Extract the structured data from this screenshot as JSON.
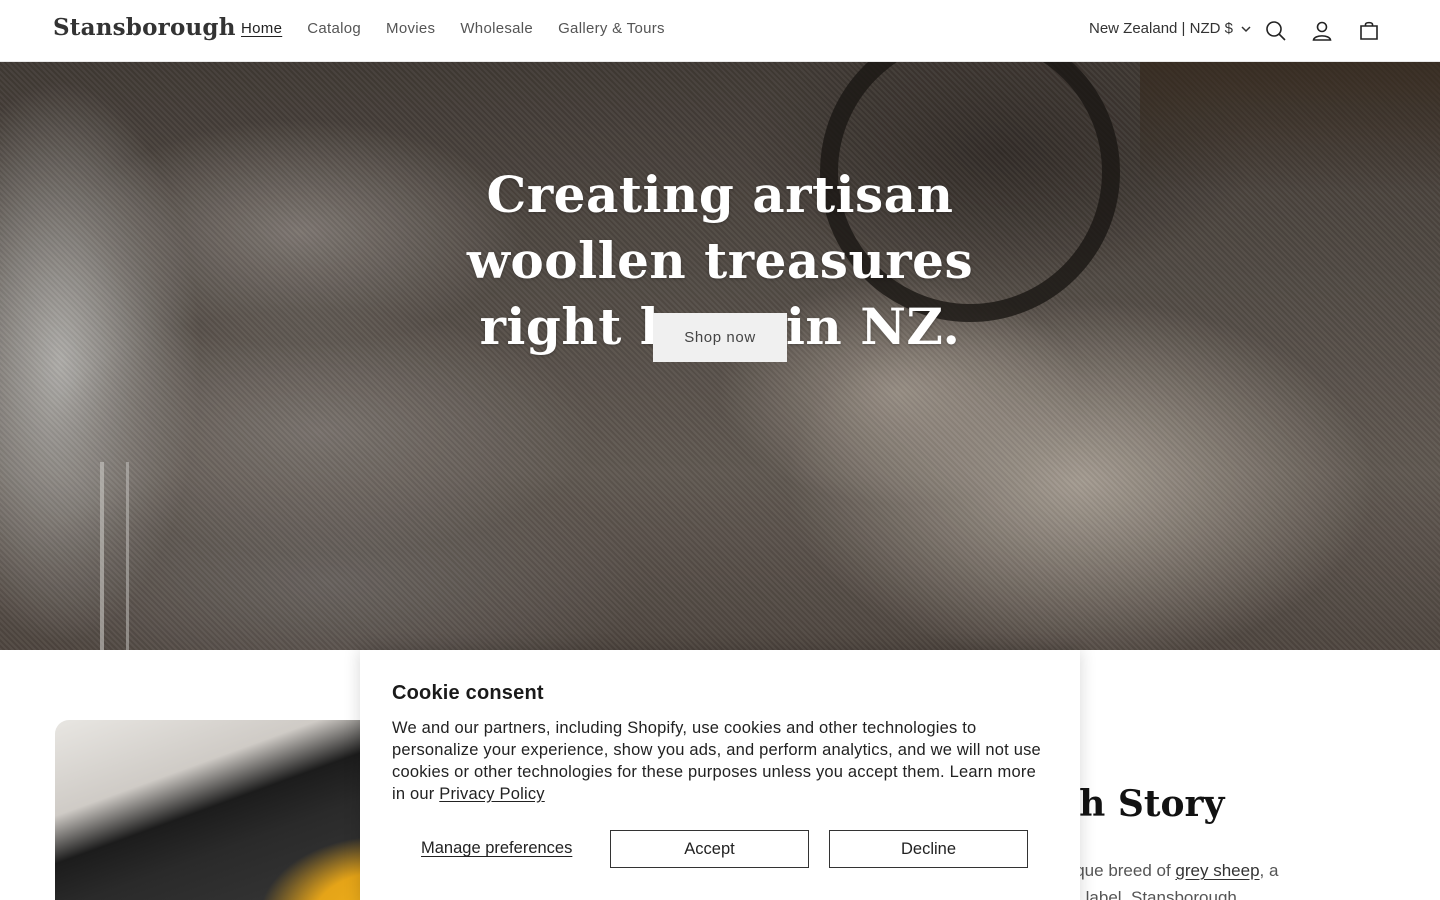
{
  "header": {
    "logo": "Stansborough",
    "nav": [
      "Home",
      "Catalog",
      "Movies",
      "Wholesale",
      "Gallery & Tours"
    ],
    "country": "New Zealand | NZD $",
    "icons": [
      "search-icon",
      "account-icon",
      "cart-icon"
    ]
  },
  "hero": {
    "title": "Creating artisan woollen treasures right here in NZ.",
    "button": "Shop now"
  },
  "story": {
    "title_visible": "gh Story",
    "text_line1_prefix": "nique breed of ",
    "text_link": "grey sheep",
    "text_line1_suffix": ", a",
    "text_line2": "on label. Stansborough"
  },
  "cookie": {
    "title": "Cookie consent",
    "body": "We and our partners, including Shopify, use cookies and other technologies to personalize your experience, show you ads, and perform analytics, and we will not use cookies or other technologies for these purposes unless you accept them. Learn more in our ",
    "privacy_link": "Privacy Policy",
    "manage": "Manage preferences",
    "accept": "Accept",
    "decline": "Decline"
  },
  "colors": {
    "background": "#ffffff",
    "text": "#121212",
    "button_bg": "#f0f0f0"
  }
}
